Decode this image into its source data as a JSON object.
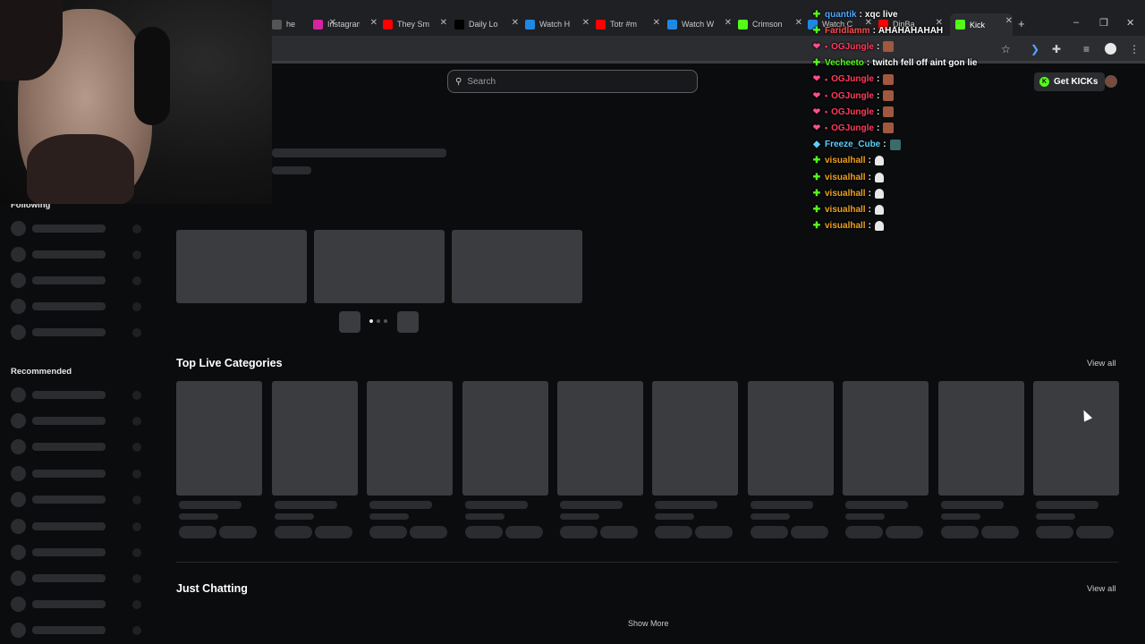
{
  "browser": {
    "tabs": [
      {
        "title": "he",
        "icon": "generic-tab-icon",
        "color": "#555"
      },
      {
        "title": "Instagram",
        "icon": "instagram-icon",
        "color": "#d6249f"
      },
      {
        "title": "They Sm",
        "icon": "youtube-icon",
        "color": "#ff0000"
      },
      {
        "title": "Daily Lo",
        "icon": "x-icon",
        "color": "#000000"
      },
      {
        "title": "Watch H",
        "icon": "stream-icon",
        "color": "#1e88e5"
      },
      {
        "title": "Totr #m",
        "icon": "youtube-icon",
        "color": "#ff0000"
      },
      {
        "title": "Watch W",
        "icon": "stream-icon",
        "color": "#1e88e5"
      },
      {
        "title": "Crimson",
        "icon": "kick-icon",
        "color": "#53fc18"
      },
      {
        "title": "Watch C",
        "icon": "stream-icon",
        "color": "#1e88e5"
      },
      {
        "title": "DinBa",
        "icon": "youtube-icon",
        "color": "#ff0000"
      },
      {
        "title": "Kick",
        "icon": "kick-icon",
        "color": "#53fc18",
        "active": true
      }
    ],
    "new_tab_label": "+",
    "minimize": "–",
    "maximize": "❐",
    "close": "✕"
  },
  "header": {
    "search_placeholder": "Search",
    "get_kicks_label": "Get KICKs"
  },
  "sidebar": {
    "following_label": "Following",
    "recommended_label": "Recommended"
  },
  "sections": [
    {
      "title": "Top Live Categories",
      "view_all": "View all"
    },
    {
      "title": "Just Chatting",
      "view_all": "View all"
    }
  ],
  "show_more_label": "Show More",
  "chat": {
    "messages": [
      {
        "user": "quantik",
        "user_color": "#53a8ff",
        "badge": "plus",
        "text": "xqc live",
        "emote": ""
      },
      {
        "user": "Faridlamm",
        "user_color": "#ff4d4d",
        "badge": "plus",
        "text": "AHAHAHAHAH",
        "emote": ""
      },
      {
        "user": "OGJungle",
        "user_color": "#ff3b5c",
        "badge": "pink",
        "text": "",
        "emote": "img"
      },
      {
        "user": "Vecheeto",
        "user_color": "#53fc18",
        "badge": "plus",
        "text": "twitch fell off aint gon lie",
        "emote": ""
      },
      {
        "user": "OGJungle",
        "user_color": "#ff3b5c",
        "badge": "pink",
        "text": "",
        "emote": "img"
      },
      {
        "user": "OGJungle",
        "user_color": "#ff3b5c",
        "badge": "pink",
        "text": "",
        "emote": "img"
      },
      {
        "user": "OGJungle",
        "user_color": "#ff3b5c",
        "badge": "pink",
        "text": "",
        "emote": "img"
      },
      {
        "user": "OGJungle",
        "user_color": "#ff3b5c",
        "badge": "pink",
        "text": "",
        "emote": "img"
      },
      {
        "user": "Freeze_Cube",
        "user_color": "#5ad0ff",
        "badge": "cube",
        "text": "",
        "emote": "cube"
      },
      {
        "user": "visualhall",
        "user_color": "#f0a020",
        "badge": "plus",
        "text": "",
        "emote": "ghost"
      },
      {
        "user": "visualhall",
        "user_color": "#f0a020",
        "badge": "plus",
        "text": "",
        "emote": "ghost"
      },
      {
        "user": "visualhall",
        "user_color": "#f0a020",
        "badge": "plus",
        "text": "",
        "emote": "ghost"
      },
      {
        "user": "visualhall",
        "user_color": "#f0a020",
        "badge": "plus",
        "text": "",
        "emote": "ghost"
      },
      {
        "user": "visualhall",
        "user_color": "#f0a020",
        "badge": "plus",
        "text": "",
        "emote": "ghost"
      }
    ]
  },
  "colors": {
    "accent": "#53fc18",
    "background": "#0b0c0d",
    "skeleton": "#3a3c40"
  }
}
